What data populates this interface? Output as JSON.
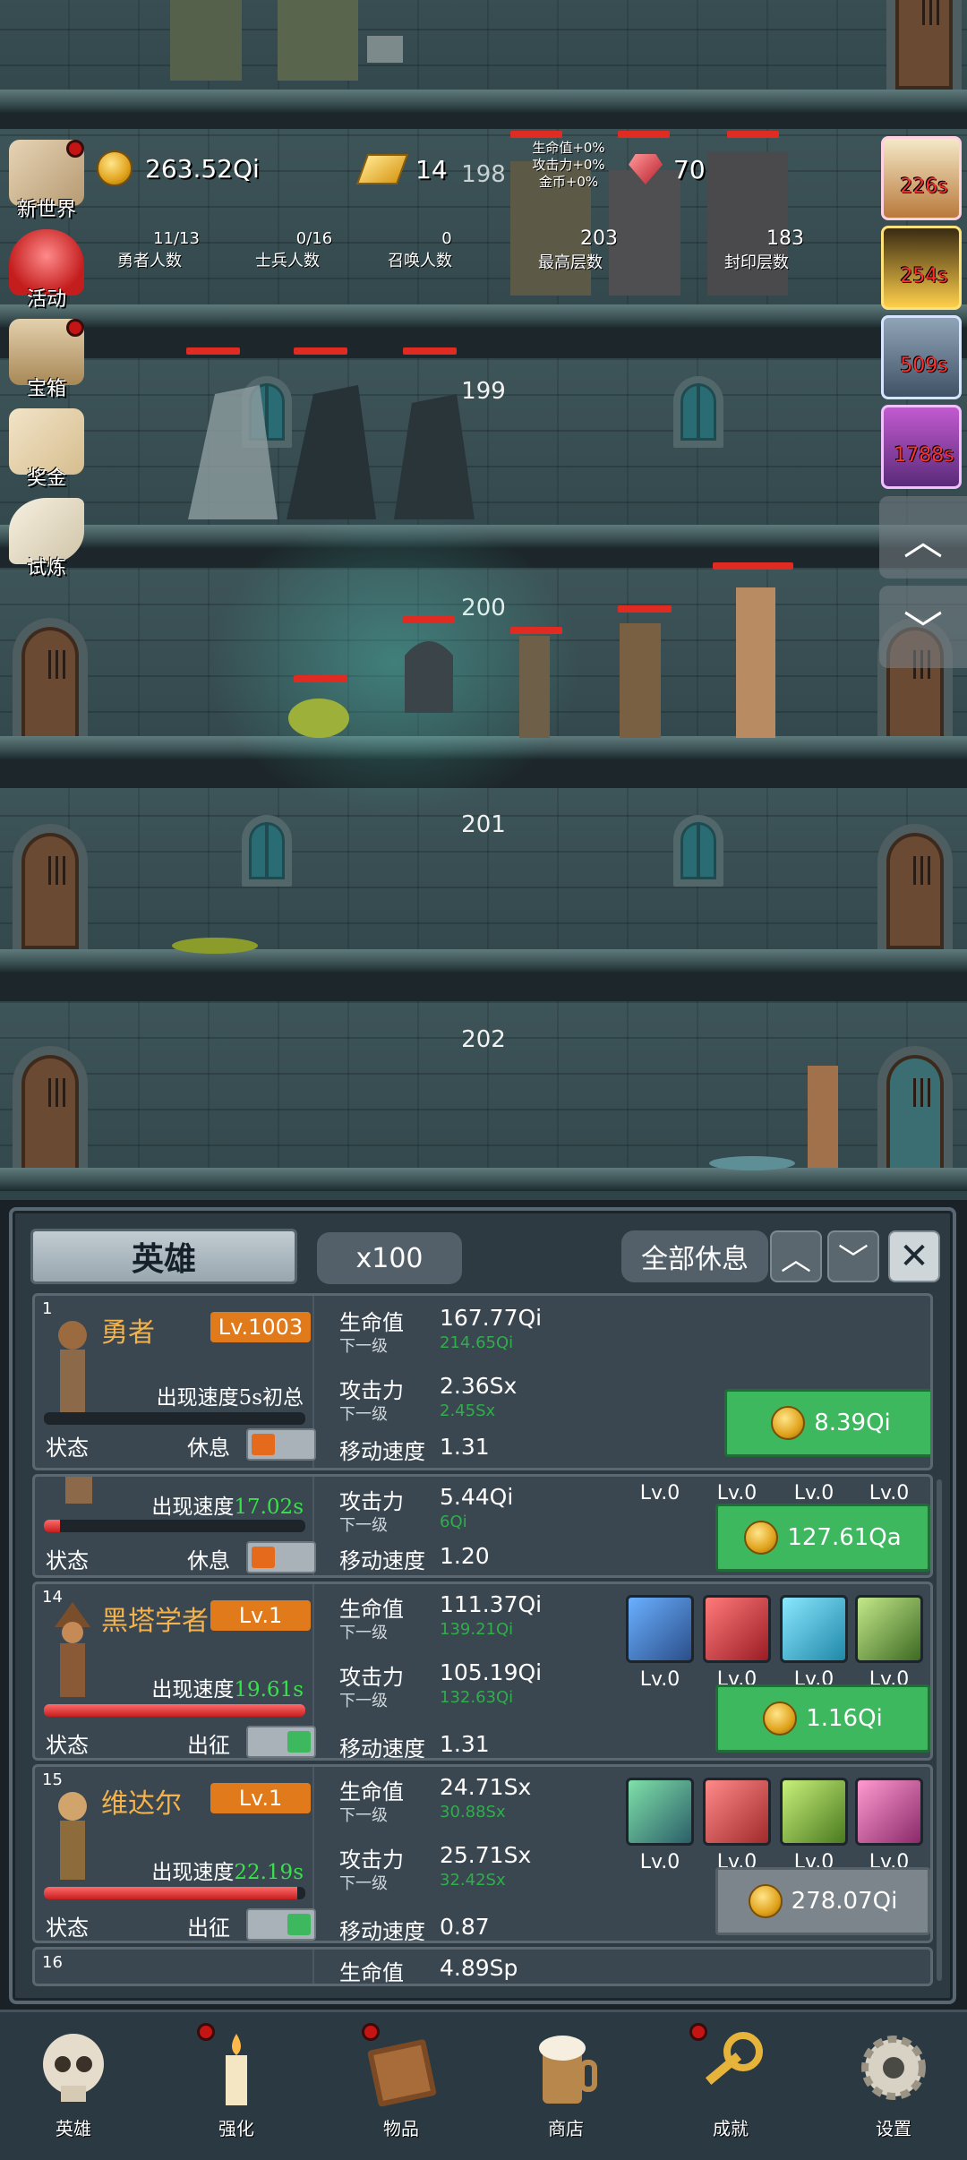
{
  "top": {
    "gold": "263.52Qi",
    "gold_bars": "14",
    "rubies": "70",
    "hero_count": "11/13",
    "hero_count_label": "勇者人数",
    "soldier_count": "0/16",
    "soldier_count_label": "士兵人数",
    "summon_count": "0",
    "summon_count_label": "召唤人数",
    "max_floor": "203",
    "max_floor_label": "最高层数",
    "sealed_floor": "183",
    "sealed_floor_label": "封印层数",
    "buff_hp": "生命值+0%",
    "buff_atk": "攻击力+0%",
    "buff_gold": "金币+0%"
  },
  "tower": {
    "floors": [
      "198",
      "199",
      "200",
      "201",
      "202"
    ]
  },
  "side_menu": [
    "新世界",
    "活动",
    "宝箱",
    "奖金",
    "试炼"
  ],
  "timers": [
    "226s",
    "254s",
    "509s",
    "1788s"
  ],
  "panel": {
    "title": "英雄",
    "multiplier": "x100",
    "rest_all": "全部休息",
    "state_label": "状态",
    "move_speed_label": "移动速度",
    "hp_label": "生命值",
    "atk_label": "攻击力",
    "next_label": "下一级",
    "speed_prefix": "出现速度",
    "skill_level": "Lv.0"
  },
  "heroes": [
    {
      "index": "1",
      "name": "勇者",
      "level": "Lv.1003",
      "speed": "5s初总",
      "speed_color": "white",
      "hp_fraction": 0,
      "state": "休息",
      "hp": "167.77Qi",
      "hp_next": "214.65Qi",
      "atk": "2.36Sx",
      "atk_next": "2.45Sx",
      "move_speed": "1.31",
      "cost": "8.39Qi",
      "cost_enabled": true
    },
    {
      "index": "",
      "name": "",
      "level": "",
      "speed": "17.02s",
      "hp_fraction": 0.06,
      "state": "休息",
      "atk": "5.44Qi",
      "atk_next": "6Qi",
      "move_speed": "1.20",
      "cost": "127.61Qa",
      "cost_enabled": true
    },
    {
      "index": "14",
      "name": "黑塔学者",
      "level": "Lv.1",
      "speed": "19.61s",
      "hp_fraction": 1.0,
      "state": "出征",
      "hp": "111.37Qi",
      "hp_next": "139.21Qi",
      "atk": "105.19Qi",
      "atk_next": "132.63Qi",
      "move_speed": "1.31",
      "cost": "1.16Qi",
      "cost_enabled": true
    },
    {
      "index": "15",
      "name": "维达尔",
      "level": "Lv.1",
      "speed": "22.19s",
      "hp_fraction": 0.97,
      "state": "出征",
      "hp": "24.71Sx",
      "hp_next": "30.88Sx",
      "atk": "25.71Sx",
      "atk_next": "32.42Sx",
      "move_speed": "0.87",
      "cost": "278.07Qi",
      "cost_enabled": false
    },
    {
      "index": "16",
      "hp": "4.89Sp"
    }
  ],
  "nav": [
    "英雄",
    "强化",
    "物品",
    "商店",
    "成就",
    "设置"
  ],
  "colors": {
    "accent_orange": "#e07a1a",
    "buy_green": "#3db85e",
    "hp_red": "#e02b22",
    "next_green": "#2fae4a"
  }
}
